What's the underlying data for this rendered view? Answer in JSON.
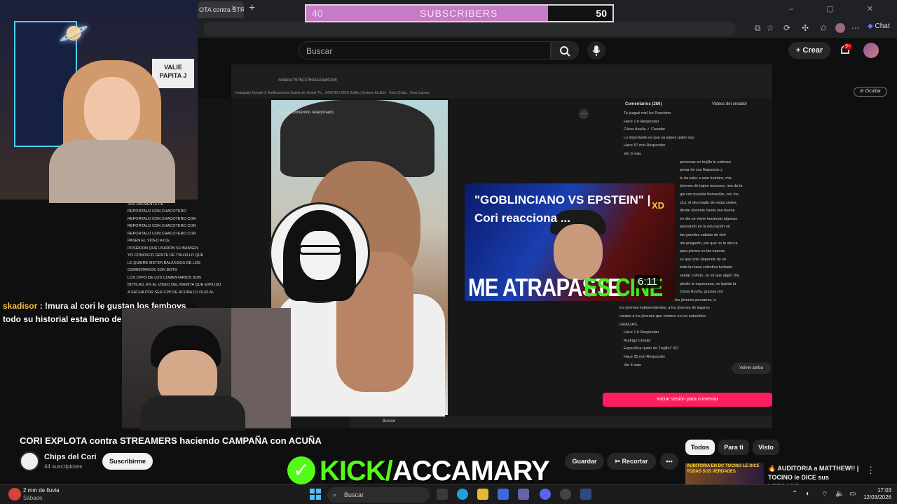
{
  "browser": {
    "tab_title": "OTA contra STR",
    "close_glyph": "×",
    "new_tab_glyph": "+",
    "window_controls": "–  ▢  ✕",
    "chat_label": "Chat"
  },
  "overlay": {
    "subscribers_current": "40",
    "subscribers_label": "SUBSCRIBERS",
    "subscribers_goal": "50",
    "subscribers_progress": 0.79,
    "kick_label": "KICK/",
    "kick_handle": "ACCAMARY",
    "chat_user": "skadisor",
    "chat_message": " : !mura al cori le gustan los femboys todo su historial esta lleno de eso"
  },
  "youtube": {
    "search_placeholder": "Buscar",
    "create_label": "Crear",
    "notifications_badge": "9+",
    "hide_label": "Ocultar",
    "video_title": "CORI EXPLOTA contra STREAMERS haciendo CAMPAÑA con ACUÑA",
    "channel_name": "Chips del Cori",
    "subscriber_count": "44 suscriptores",
    "subscribe_label": "Suscribirme",
    "save_label": "Guardar",
    "clip_label": "Recortar",
    "more_label": "•••",
    "filter_chips": [
      "Todos",
      "Para ti",
      "Visto"
    ],
    "recommended": {
      "thumb_text": "AUDITORIA EN DC TOCINO LE DICE TODAS SUS VERDADES",
      "title": "🔥 AUDITORIA a MATTHEW!! | TOCINO le DICE sus VERDADE..."
    }
  },
  "embedded": {
    "url": "/videos/7576137504AA/ud0108",
    "bookmarks": "Instagram   Google   X   Notificaciones   Suerte de Grand Th...   SORTEO KICK   Bolfla | Sorteos   Kickfun - Kick Chatb...   Drop Lapras",
    "photo_search": "Buscar contenido relacionado",
    "comments_tab": "Comentarios (286)",
    "creator_tab": "Videos del creador",
    "comment_lines": [
      "Te juzgué mal Ice Poseidon",
      "Hace 1 h   Responder",
      "César Acuña ✓ Creador",
      "Lo importante es que ya sabes quien soy.",
      "Hace 57 min   Responder",
      "Ver 3 más",
      "personas en trujillo le estiman",
      "pesar de sus flaquezas y",
      "le da valor a este hombre, mis",
      "jóvenes de bajos recursos, nos da la",
      "gui con nuestra formación, con los",
      "Ucv, el alumnado de estas cedes,",
      "desde docente hasta una buena",
      "en día se viene haciendo algunas",
      "pensando en la educación en",
      "las grandes salidas de vivir",
      "me pregunto, por qué no le dan la",
      "para piensa en las nuevas",
      "se que solo depende de un",
      "toda la masa colectiva luchado",
      "sentar común, yo sé que algún día",
      "pierde la esperanza, no ijuzido la",
      "César Acuña, gracias por",
      "brindarnos beneficios o becas a los jóvenes peruanos, a",
      "los jóvenes independientes, a los jóvenes de lugares",
      "rurales a los jóvenes que vivimos en los suburbios.",
      "GRACIAS.",
      "Hace 1 h   Responder",
      "Rodrigo Chedet",
      "Específica quién de Trujillo? XD",
      "Hace 35 min   Responder",
      "Ver 4 más"
    ],
    "back_to_top": "Volver arriba",
    "login_label": "Iniciar sesión para comentar",
    "taskbar_search": "Buscar",
    "chat_lines": [
      "CHACOTERO",
      "CON",
      "ELLOS ACABARON EL COLEGIO",
      "VIRTUALMENTE PE",
      "REPORTALO CON CHACOTERO",
      "REPORTALO CON CHACOTERO COR",
      "REPORTALO CON CHACOTERO CON",
      "REPORTALO CON CHACOTERO COR",
      "PASEN EL VIDEO A ICE",
      "POSEIDON QUE USARON SU BANSEN",
      "YO CONOSCO GENTE DE TRUJILLO QUE",
      "LE QUIERE METER BALA ESOS DE LOS",
      "COMENTARIOS SON BOTS",
      "LOS CPPS DE LOS COMENTARIOS SON",
      "BOTILAS, EN EL VIDEO DEL MAMITA QUE EXPLISO",
      "A SACHA POR SER CPP DE ACUÑA LO OLIO AL"
    ]
  },
  "thumbnail": {
    "title": "\"GOBLINCIANO VS EPSTEIN\" | Cori reacciona ...",
    "big_text": "ME ATRAPASTE",
    "big_text_green": "ES CINE",
    "corner_text": "XD",
    "duration": "6:11"
  },
  "webcam": {
    "sign_text": "VALIE PAPITA J"
  },
  "taskbar": {
    "weather_temp": "2 mm de lluvia",
    "weather_day": "Sábado",
    "search_label": "Buscar",
    "time": "17:03",
    "date": "12/03/2026"
  },
  "colors": {
    "sub_fill": "#c77ac5",
    "kick_green": "#53fc18",
    "login_pink": "#ff1d5e"
  }
}
